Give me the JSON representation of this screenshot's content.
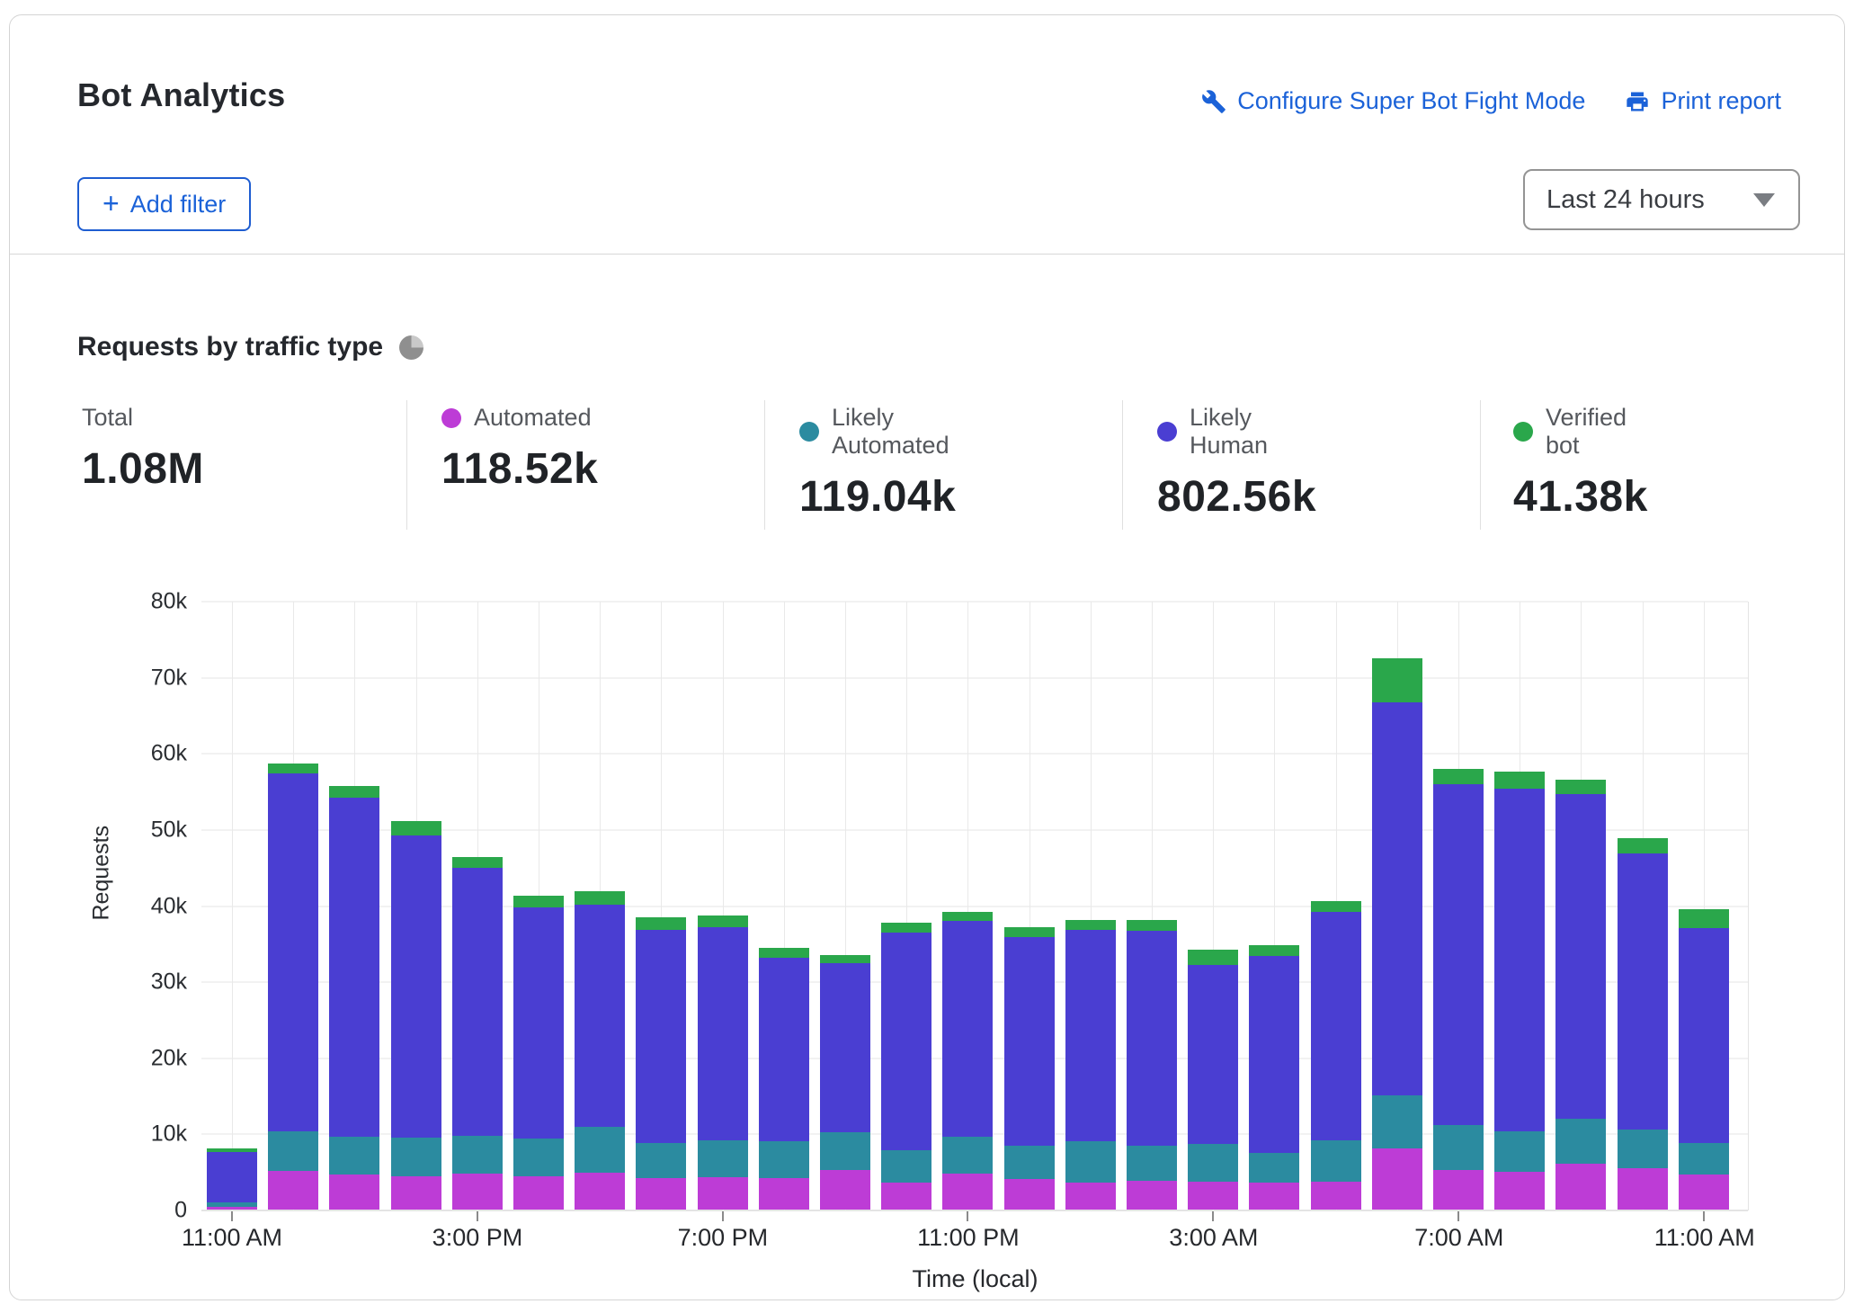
{
  "header": {
    "title": "Bot Analytics",
    "configure_link": "Configure Super Bot Fight Mode",
    "print_link": "Print report",
    "add_filter_label": "Add filter",
    "time_range_value": "Last 24 hours"
  },
  "section": {
    "title": "Requests by traffic type"
  },
  "colors": {
    "link_blue": "#1b62d8",
    "automated": "#bd3cd6",
    "likely_automated": "#2b8ba0",
    "likely_human": "#4a3ed2",
    "verified_bot": "#2aa74b"
  },
  "stats": [
    {
      "label": "Total",
      "value": "1.08M",
      "dot": ""
    },
    {
      "label": "Automated",
      "value": "118.52k",
      "dot": "#bd3cd6"
    },
    {
      "label": "Likely Automated",
      "value": "119.04k",
      "dot": "#2b8ba0"
    },
    {
      "label": "Likely Human",
      "value": "802.56k",
      "dot": "#4a3ed2"
    },
    {
      "label": "Verified bot",
      "value": "41.38k",
      "dot": "#2aa74b"
    }
  ],
  "chart_data": {
    "type": "bar",
    "stacked": true,
    "title": "Requests by traffic type",
    "xlabel": "Time (local)",
    "ylabel": "Requests",
    "ylim": [
      0,
      80000
    ],
    "yticks": [
      "0",
      "10k",
      "20k",
      "30k",
      "40k",
      "50k",
      "60k",
      "70k",
      "80k"
    ],
    "grid": true,
    "x": [
      "11:00 AM",
      "12:00 PM",
      "1:00 PM",
      "2:00 PM",
      "3:00 PM",
      "4:00 PM",
      "5:00 PM",
      "6:00 PM",
      "7:00 PM",
      "8:00 PM",
      "9:00 PM",
      "10:00 PM",
      "11:00 PM",
      "12:00 AM",
      "1:00 AM",
      "2:00 AM",
      "3:00 AM",
      "4:00 AM",
      "5:00 AM",
      "6:00 AM",
      "7:00 AM",
      "8:00 AM",
      "9:00 AM",
      "10:00 AM",
      "11:00 AM"
    ],
    "xtick_indices": [
      0,
      4,
      8,
      12,
      16,
      20,
      24
    ],
    "series": [
      {
        "name": "Automated",
        "color": "#bd3cd6",
        "values": [
          300,
          5100,
          4600,
          4400,
          4700,
          4400,
          4800,
          4100,
          4300,
          4100,
          5200,
          3500,
          4700,
          4000,
          3500,
          3800,
          3700,
          3500,
          3700,
          8000,
          5200,
          5000,
          6000,
          5400,
          4600
        ]
      },
      {
        "name": "Likely Automated",
        "color": "#2b8ba0",
        "values": [
          700,
          5200,
          5000,
          5100,
          5000,
          4900,
          6100,
          4700,
          4800,
          4900,
          5000,
          4300,
          4900,
          4400,
          5500,
          4600,
          4900,
          3900,
          5400,
          7000,
          5900,
          5300,
          5900,
          5100,
          4100
        ]
      },
      {
        "name": "Likely Human",
        "color": "#4a3ed2",
        "values": [
          6600,
          47000,
          44500,
          39700,
          35200,
          30400,
          29200,
          28000,
          28000,
          24100,
          22200,
          28600,
          28300,
          27400,
          27800,
          28200,
          23600,
          25900,
          30000,
          51600,
          44800,
          45000,
          42700,
          36300,
          28300
        ]
      },
      {
        "name": "Verified bot",
        "color": "#2aa74b",
        "values": [
          400,
          1300,
          1600,
          1900,
          1400,
          1600,
          1700,
          1600,
          1600,
          1300,
          1100,
          1300,
          1200,
          1300,
          1200,
          1400,
          1900,
          1500,
          1400,
          5900,
          2000,
          2200,
          1900,
          2000,
          2500
        ]
      }
    ],
    "totals_legend": {
      "Total": "1.08M",
      "Automated": "118.52k",
      "Likely Automated": "119.04k",
      "Likely Human": "802.56k",
      "Verified bot": "41.38k"
    }
  }
}
